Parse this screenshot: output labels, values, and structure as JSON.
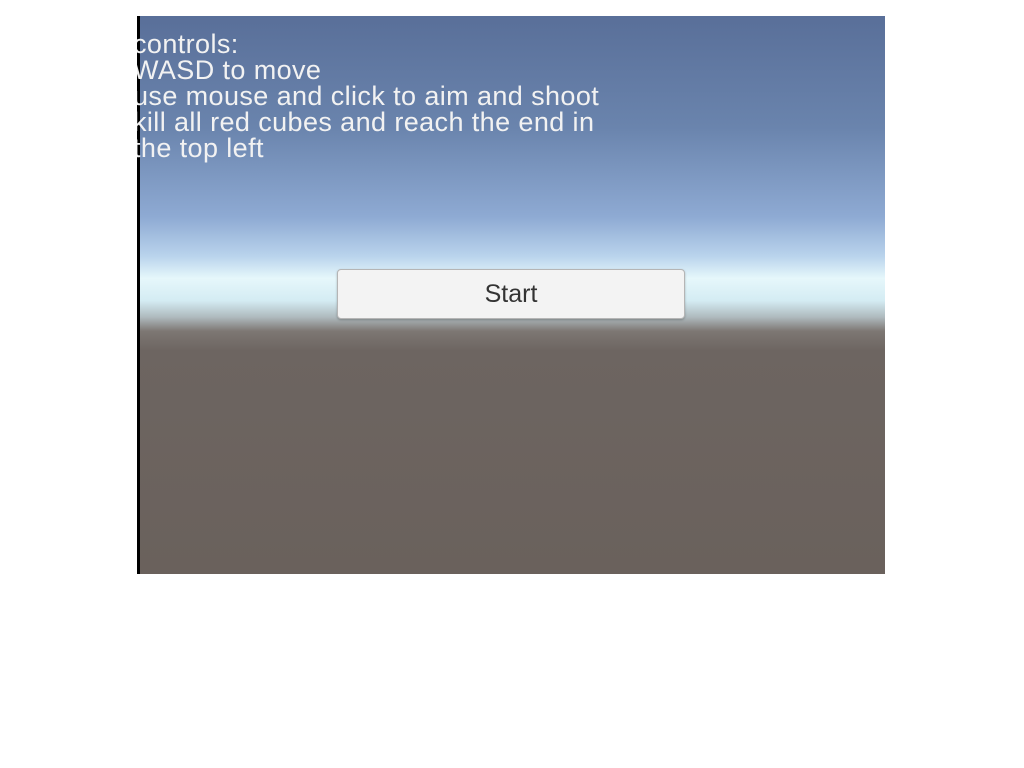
{
  "instructions": [
    "controls:",
    "WASD to move",
    "use mouse and click to aim and shoot",
    "kill all red cubes and reach the end in",
    "the top left"
  ],
  "start_button": {
    "label": "Start"
  },
  "colors": {
    "sky_top": "#596f99",
    "horizon": "#e6f7fb",
    "ground": "#6a615c",
    "button_bg": "#f3f3f3",
    "text": "#f2f2f2"
  }
}
